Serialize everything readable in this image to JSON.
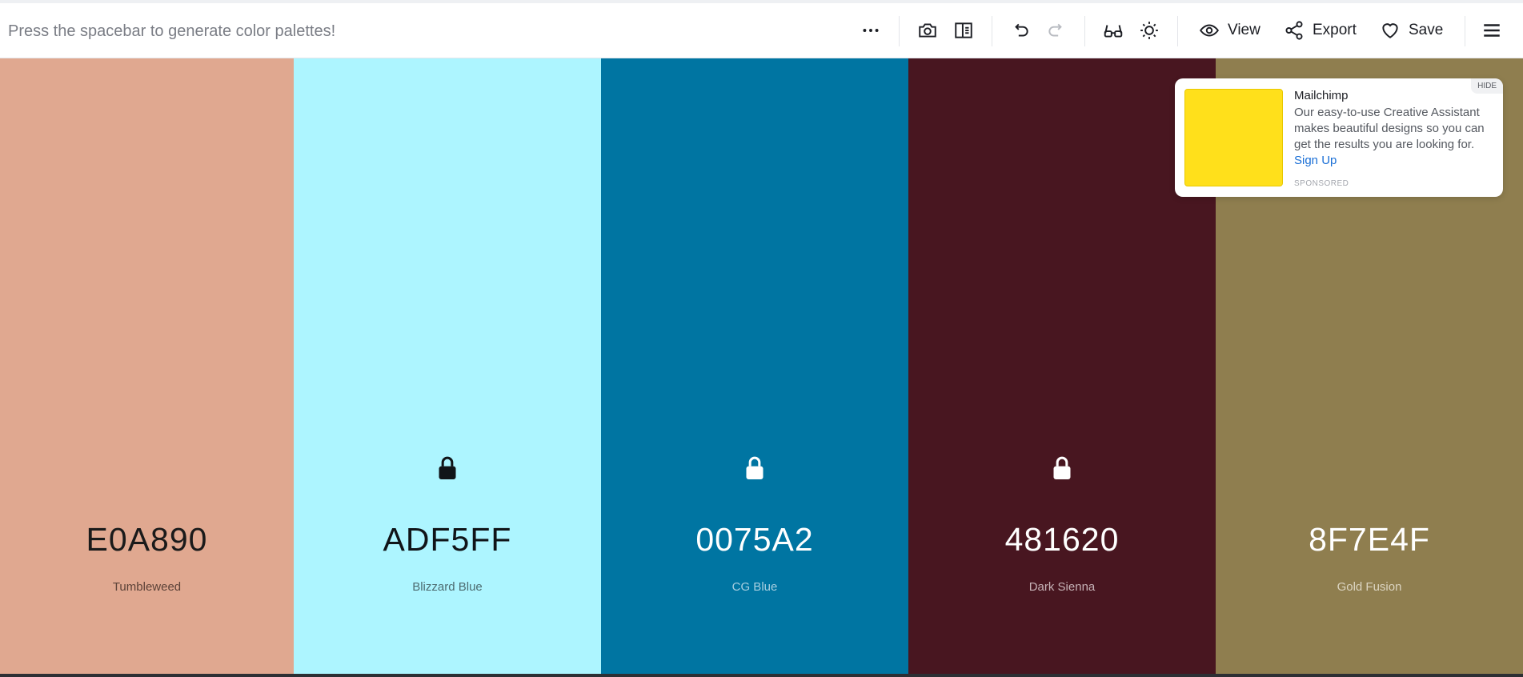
{
  "toolbar": {
    "hint": "Press the spacebar to generate color palettes!",
    "view_label": "View",
    "export_label": "Export",
    "save_label": "Save",
    "icons": [
      "more-icon",
      "camera-icon",
      "side-panel-icon",
      "undo-icon",
      "redo-icon",
      "glasses-icon",
      "brightness-icon",
      "eye-icon",
      "share-icon",
      "heart-icon",
      "menu-icon"
    ]
  },
  "palette": {
    "swatches": [
      {
        "hex": "E0A890",
        "name": "Tumbleweed",
        "color": "#E0A890",
        "text_color": "#1a1a1a",
        "name_color": "#5c4238",
        "locked": false
      },
      {
        "hex": "ADF5FF",
        "name": "Blizzard Blue",
        "color": "#ADF5FF",
        "text_color": "#101418",
        "name_color": "#4d6b70",
        "locked": true
      },
      {
        "hex": "0075A2",
        "name": "CG Blue",
        "color": "#0075A2",
        "text_color": "#ffffff",
        "name_color": "#a8cfe0",
        "locked": true
      },
      {
        "hex": "481620",
        "name": "Dark Sienna",
        "color": "#481620",
        "text_color": "#ffffff",
        "name_color": "#c6b3b7",
        "locked": true
      },
      {
        "hex": "8F7E4F",
        "name": "Gold Fusion",
        "color": "#8F7E4F",
        "text_color": "#ffffff",
        "name_color": "#dcd5c2",
        "locked": false
      }
    ]
  },
  "ad": {
    "title": "Mailchimp",
    "text": "Our easy-to-use Creative Assistant makes beautiful designs so you can get the results you are looking for.",
    "link": "Sign Up",
    "sponsored": "SPONSORED",
    "hide": "HIDE",
    "image_color": "#FFE01B"
  }
}
